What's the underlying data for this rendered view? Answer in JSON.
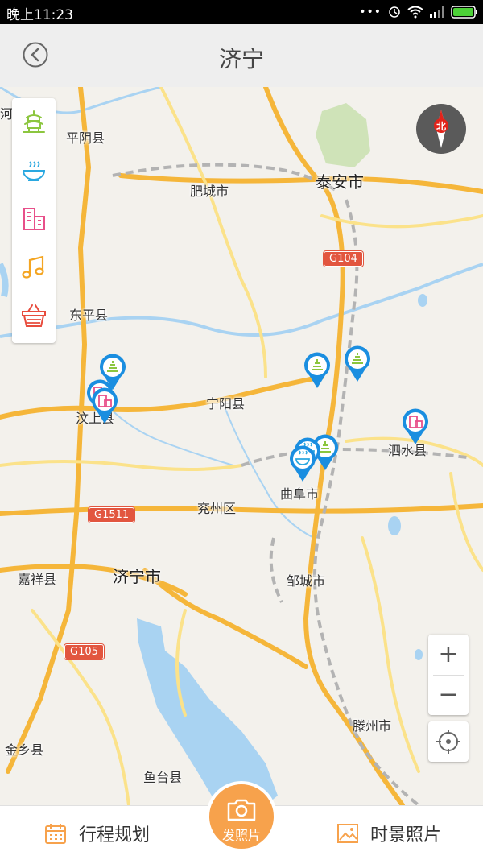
{
  "status_bar": {
    "time": "晚上11:23"
  },
  "header": {
    "title": "济宁"
  },
  "map": {
    "labels": {
      "he_xian": "河县",
      "pingyin": "平阴县",
      "feicheng": "肥城市",
      "taian": "泰安市",
      "dongping": "东平县",
      "ningyang": "宁阳县",
      "wenshang": "汶上县",
      "sishui": "泗水县",
      "qufu": "曲阜市",
      "yanzhou": "兖州区",
      "jiaxiang": "嘉祥县",
      "jining": "济宁市",
      "zoucheng": "邹城市",
      "tengzhou": "滕州市",
      "jinxiang": "金乡县",
      "yutai": "鱼台县"
    },
    "road_shields": {
      "g104": "G104",
      "g1511": "G1511",
      "g105": "G105"
    },
    "compass_label": "北",
    "zoom_in": "+",
    "zoom_out": "−"
  },
  "categories": [
    {
      "name": "scenic",
      "icon": "pagoda-icon",
      "color": "#8cc63f"
    },
    {
      "name": "food",
      "icon": "bowl-icon",
      "color": "#2aa8e0"
    },
    {
      "name": "hotel",
      "icon": "building-icon",
      "color": "#e8508a"
    },
    {
      "name": "entertainment",
      "icon": "music-note-icon",
      "color": "#f4a522"
    },
    {
      "name": "shopping",
      "icon": "basket-icon",
      "color": "#e84c3d"
    }
  ],
  "bottom_bar": {
    "itinerary": "行程规划",
    "post_photo": "发照片",
    "scenic_photos": "时景照片"
  },
  "colors": {
    "accent": "#f7a24c",
    "pin": "#1a8ee0",
    "highway": "#f5b63a"
  }
}
